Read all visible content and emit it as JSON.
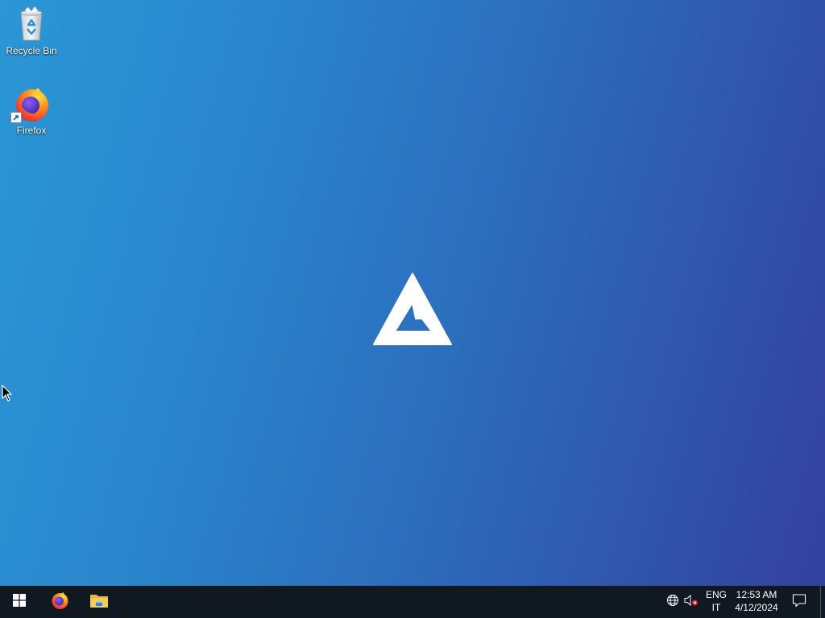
{
  "desktop": {
    "icons": [
      {
        "label": "Recycle Bin",
        "icon": "recycle-bin-icon"
      },
      {
        "label": "Firefox",
        "icon": "firefox-icon",
        "shortcut": true
      }
    ],
    "wallpaper_logo": "triangle-logo",
    "colors": {
      "gradient_left": "#2a97d6",
      "gradient_right": "#33409e"
    }
  },
  "taskbar": {
    "background": "#101822",
    "start": {
      "icon": "windows-logo-icon"
    },
    "pinned": [
      {
        "name": "Firefox",
        "icon": "firefox-icon"
      },
      {
        "name": "File Explorer",
        "icon": "folder-icon"
      }
    ],
    "tray": {
      "network_icon": "globe-network-icon",
      "volume_icon": "volume-muted-icon",
      "language_primary": "ENG",
      "language_secondary": "IT",
      "time": "12:53 AM",
      "date": "4/12/2024",
      "notification_icon": "action-center-icon"
    }
  }
}
